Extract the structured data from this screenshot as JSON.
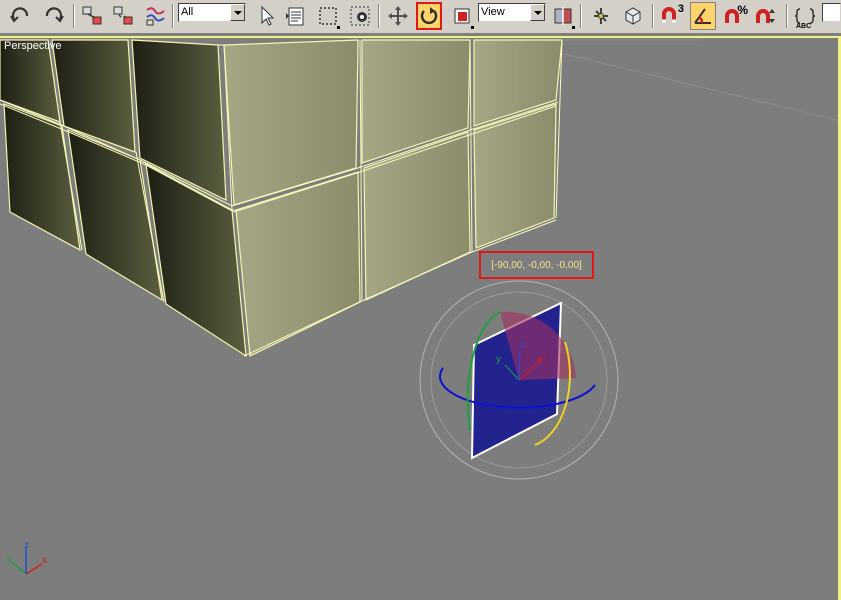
{
  "toolbar": {
    "selection_filter": "All",
    "reference_coord_system": "View",
    "snap_label": "3",
    "percent_snap_label": "%",
    "named_selection_label": "ABC"
  },
  "viewport": {
    "label": "Perspective",
    "rotate_readout": "[-90,00, -0,00, -0,00]",
    "axis_labels": {
      "x": "x",
      "y": "y",
      "z": "z"
    }
  },
  "colors": {
    "active_highlight": "#ffd46a",
    "active_border": "#e01818",
    "viewport_border": "#f0f088",
    "readout_text": "#f3e58c"
  }
}
